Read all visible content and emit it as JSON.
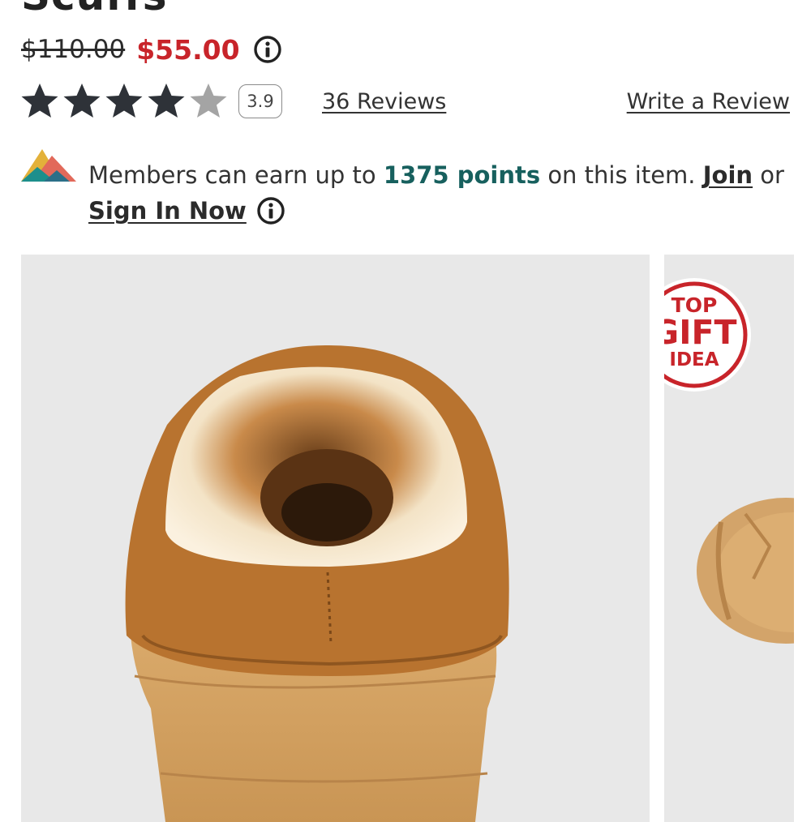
{
  "product": {
    "title": "Scuffs",
    "price_original": "$110.00",
    "price_sale": "$55.00",
    "rating_value": 3.9,
    "rating_label": "3.9",
    "stars_max": 5,
    "reviews_link": "36 Reviews",
    "write_review_link": "Write a Review"
  },
  "members": {
    "text_prefix": "Members can earn up to",
    "points": "1375 points",
    "text_mid": "on this item.",
    "join_link": "Join",
    "text_or": "or",
    "signin_link": "Sign In Now"
  },
  "gallery": {
    "badge": {
      "top": "TOP",
      "gift": "GIFT",
      "idea": "IDEA"
    }
  },
  "icons": {
    "price_info": "info-circle-icon",
    "members_info": "info-circle-icon",
    "members_logo": "mountain-logo-icon",
    "stars": "star-icon"
  },
  "colors": {
    "sale_red": "#c8242a",
    "points_teal": "#17605e",
    "star_filled": "#2e3238",
    "star_empty": "#a4a4a4",
    "gallery_bg": "#e8e8e8"
  }
}
